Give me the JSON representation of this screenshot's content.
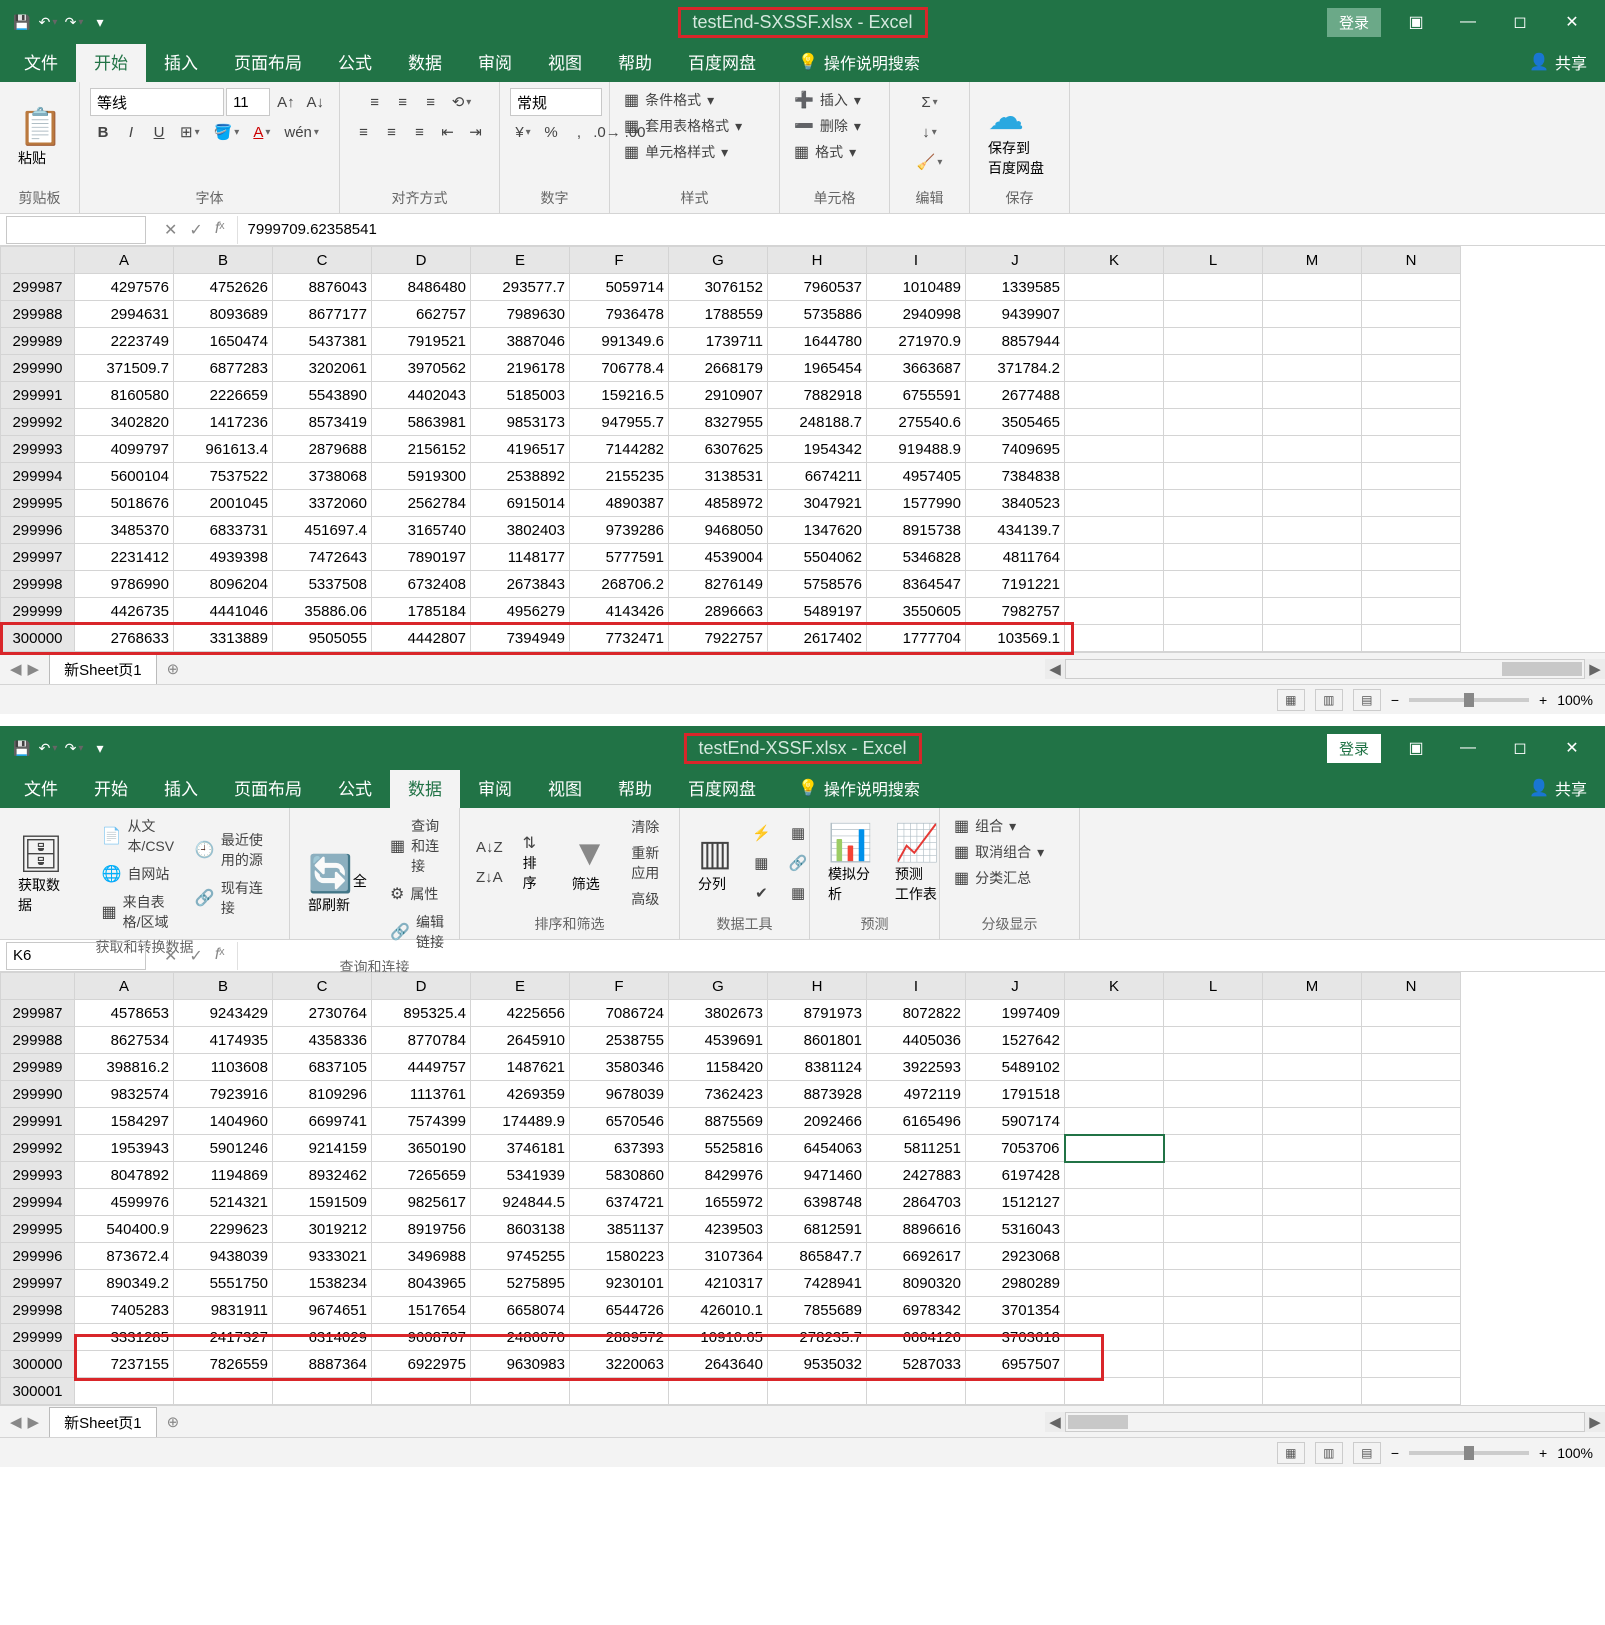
{
  "win1": {
    "title": "testEnd-SXSSF.xlsx  -  Excel",
    "login": "登录",
    "tabs": [
      "文件",
      "开始",
      "插入",
      "页面布局",
      "公式",
      "数据",
      "审阅",
      "视图",
      "帮助",
      "百度网盘"
    ],
    "active_tab": 1,
    "help_search": "操作说明搜索",
    "share": "共享",
    "ribbon": {
      "clipboard": {
        "paste": "粘贴",
        "label": "剪贴板"
      },
      "font": {
        "name": "等线",
        "size": "11",
        "label": "字体"
      },
      "align": {
        "label": "对齐方式"
      },
      "number": {
        "format": "常规",
        "label": "数字"
      },
      "styles": {
        "cond": "条件格式",
        "table": "套用表格格式",
        "cell": "单元格样式",
        "label": "样式"
      },
      "cells": {
        "insert": "插入",
        "delete": "删除",
        "format": "格式",
        "label": "单元格"
      },
      "editing": {
        "label": "编辑"
      },
      "save": {
        "btn": "保存到\n百度网盘",
        "label": "保存"
      }
    },
    "formula_value": "7999709.62358541",
    "name_box": "",
    "columns": [
      "A",
      "B",
      "C",
      "D",
      "E",
      "F",
      "G",
      "H",
      "I",
      "J",
      "K",
      "L",
      "M",
      "N"
    ],
    "rows": [
      {
        "n": "299987",
        "v": [
          "4297576",
          "4752626",
          "8876043",
          "8486480",
          "293577.7",
          "5059714",
          "3076152",
          "7960537",
          "1010489",
          "1339585"
        ]
      },
      {
        "n": "299988",
        "v": [
          "2994631",
          "8093689",
          "8677177",
          "662757",
          "7989630",
          "7936478",
          "1788559",
          "5735886",
          "2940998",
          "9439907"
        ]
      },
      {
        "n": "299989",
        "v": [
          "2223749",
          "1650474",
          "5437381",
          "7919521",
          "3887046",
          "991349.6",
          "1739711",
          "1644780",
          "271970.9",
          "8857944"
        ]
      },
      {
        "n": "299990",
        "v": [
          "371509.7",
          "6877283",
          "3202061",
          "3970562",
          "2196178",
          "706778.4",
          "2668179",
          "1965454",
          "3663687",
          "371784.2"
        ]
      },
      {
        "n": "299991",
        "v": [
          "8160580",
          "2226659",
          "5543890",
          "4402043",
          "5185003",
          "159216.5",
          "2910907",
          "7882918",
          "6755591",
          "2677488"
        ]
      },
      {
        "n": "299992",
        "v": [
          "3402820",
          "1417236",
          "8573419",
          "5863981",
          "9853173",
          "947955.7",
          "8327955",
          "248188.7",
          "275540.6",
          "3505465"
        ]
      },
      {
        "n": "299993",
        "v": [
          "4099797",
          "961613.4",
          "2879688",
          "2156152",
          "4196517",
          "7144282",
          "6307625",
          "1954342",
          "919488.9",
          "7409695"
        ]
      },
      {
        "n": "299994",
        "v": [
          "5600104",
          "7537522",
          "3738068",
          "5919300",
          "2538892",
          "2155235",
          "3138531",
          "6674211",
          "4957405",
          "7384838"
        ]
      },
      {
        "n": "299995",
        "v": [
          "5018676",
          "2001045",
          "3372060",
          "2562784",
          "6915014",
          "4890387",
          "4858972",
          "3047921",
          "1577990",
          "3840523"
        ]
      },
      {
        "n": "299996",
        "v": [
          "3485370",
          "6833731",
          "451697.4",
          "3165740",
          "3802403",
          "9739286",
          "9468050",
          "1347620",
          "8915738",
          "434139.7"
        ]
      },
      {
        "n": "299997",
        "v": [
          "2231412",
          "4939398",
          "7472643",
          "7890197",
          "1148177",
          "5777591",
          "4539004",
          "5504062",
          "5346828",
          "4811764"
        ]
      },
      {
        "n": "299998",
        "v": [
          "9786990",
          "8096204",
          "5337508",
          "6732408",
          "2673843",
          "268706.2",
          "8276149",
          "5758576",
          "8364547",
          "7191221"
        ]
      },
      {
        "n": "299999",
        "v": [
          "4426735",
          "4441046",
          "35886.06",
          "1785184",
          "4956279",
          "4143426",
          "2896663",
          "5489197",
          "3550605",
          "7982757"
        ]
      },
      {
        "n": "300000",
        "v": [
          "2768633",
          "3313889",
          "9505055",
          "4442807",
          "7394949",
          "7732471",
          "7922757",
          "2617402",
          "1777704",
          "103569.1"
        ]
      }
    ],
    "sheet_name": "新Sheet页1",
    "zoom": "100%"
  },
  "win2": {
    "title": "testEnd-XSSF.xlsx  -  Excel",
    "login": "登录",
    "tabs": [
      "文件",
      "开始",
      "插入",
      "页面布局",
      "公式",
      "数据",
      "审阅",
      "视图",
      "帮助",
      "百度网盘"
    ],
    "active_tab": 5,
    "help_search": "操作说明搜索",
    "share": "共享",
    "ribbon": {
      "get": {
        "big": "获取数\n据",
        "csv": "从文本/CSV",
        "web": "自网站",
        "table": "来自表格/区域",
        "recent": "最近使用的源",
        "conn": "现有连接",
        "label": "获取和转换数据"
      },
      "refresh": {
        "big": "全部刷新",
        "q": "查询和连接",
        "p": "属性",
        "e": "编辑链接",
        "label": "查询和连接"
      },
      "sort": {
        "sort": "排序",
        "filter": "筛选",
        "clear": "清除",
        "reapply": "重新应用",
        "adv": "高级",
        "label": "排序和筛选"
      },
      "tools": {
        "split": "分列",
        "fill": "",
        "dup": "",
        "valid": "",
        "label": "数据工具"
      },
      "forecast": {
        "sim": "模拟分析",
        "sheet": "预测\n工作表",
        "label": "预测"
      },
      "group": {
        "g": "组合",
        "u": "取消组合",
        "s": "分类汇总",
        "label": "分级显示"
      }
    },
    "name_box": "K6",
    "formula_value": "",
    "columns": [
      "A",
      "B",
      "C",
      "D",
      "E",
      "F",
      "G",
      "H",
      "I",
      "J",
      "K",
      "L",
      "M",
      "N"
    ],
    "rows": [
      {
        "n": "299987",
        "v": [
          "4578653",
          "9243429",
          "2730764",
          "895325.4",
          "4225656",
          "7086724",
          "3802673",
          "8791973",
          "8072822",
          "1997409"
        ]
      },
      {
        "n": "299988",
        "v": [
          "8627534",
          "4174935",
          "4358336",
          "8770784",
          "2645910",
          "2538755",
          "4539691",
          "8601801",
          "4405036",
          "1527642"
        ]
      },
      {
        "n": "299989",
        "v": [
          "398816.2",
          "1103608",
          "6837105",
          "4449757",
          "1487621",
          "3580346",
          "1158420",
          "8381124",
          "3922593",
          "5489102"
        ]
      },
      {
        "n": "299990",
        "v": [
          "9832574",
          "7923916",
          "8109296",
          "1113761",
          "4269359",
          "9678039",
          "7362423",
          "8873928",
          "4972119",
          "1791518"
        ]
      },
      {
        "n": "299991",
        "v": [
          "1584297",
          "1404960",
          "6699741",
          "7574399",
          "174489.9",
          "6570546",
          "8875569",
          "2092466",
          "6165496",
          "5907174"
        ]
      },
      {
        "n": "299992",
        "v": [
          "1953943",
          "5901246",
          "9214159",
          "3650190",
          "3746181",
          "637393",
          "5525816",
          "6454063",
          "5811251",
          "7053706"
        ]
      },
      {
        "n": "299993",
        "v": [
          "8047892",
          "1194869",
          "8932462",
          "7265659",
          "5341939",
          "5830860",
          "8429976",
          "9471460",
          "2427883",
          "6197428"
        ]
      },
      {
        "n": "299994",
        "v": [
          "4599976",
          "5214321",
          "1591509",
          "9825617",
          "924844.5",
          "6374721",
          "1655972",
          "6398748",
          "2864703",
          "1512127"
        ]
      },
      {
        "n": "299995",
        "v": [
          "540400.9",
          "2299623",
          "3019212",
          "8919756",
          "8603138",
          "3851137",
          "4239503",
          "6812591",
          "8896616",
          "5316043"
        ]
      },
      {
        "n": "299996",
        "v": [
          "873672.4",
          "9438039",
          "9333021",
          "3496988",
          "9745255",
          "1580223",
          "3107364",
          "865847.7",
          "6692617",
          "2923068"
        ]
      },
      {
        "n": "299997",
        "v": [
          "890349.2",
          "5551750",
          "1538234",
          "8043965",
          "5275895",
          "9230101",
          "4210317",
          "7428941",
          "8090320",
          "2980289"
        ]
      },
      {
        "n": "299998",
        "v": [
          "7405283",
          "9831911",
          "9674651",
          "1517654",
          "6658074",
          "6544726",
          "426010.1",
          "7855689",
          "6978342",
          "3701354"
        ]
      },
      {
        "n": "299999",
        "v": [
          "3331285",
          "2417327",
          "6314029",
          "9608707",
          "2486070",
          "2889572",
          "10910.65",
          "278235.7",
          "6664126",
          "3703618"
        ]
      },
      {
        "n": "300000",
        "v": [
          "7237155",
          "7826559",
          "8887364",
          "6922975",
          "9630983",
          "3220063",
          "2643640",
          "9535032",
          "5287033",
          "6957507"
        ]
      },
      {
        "n": "300001",
        "v": [
          "",
          "",
          "",
          "",
          "",
          "",
          "",
          "",
          "",
          ""
        ]
      }
    ],
    "sel": {
      "row": "299992",
      "col": "K"
    },
    "sheet_name": "新Sheet页1",
    "zoom": "100%"
  }
}
